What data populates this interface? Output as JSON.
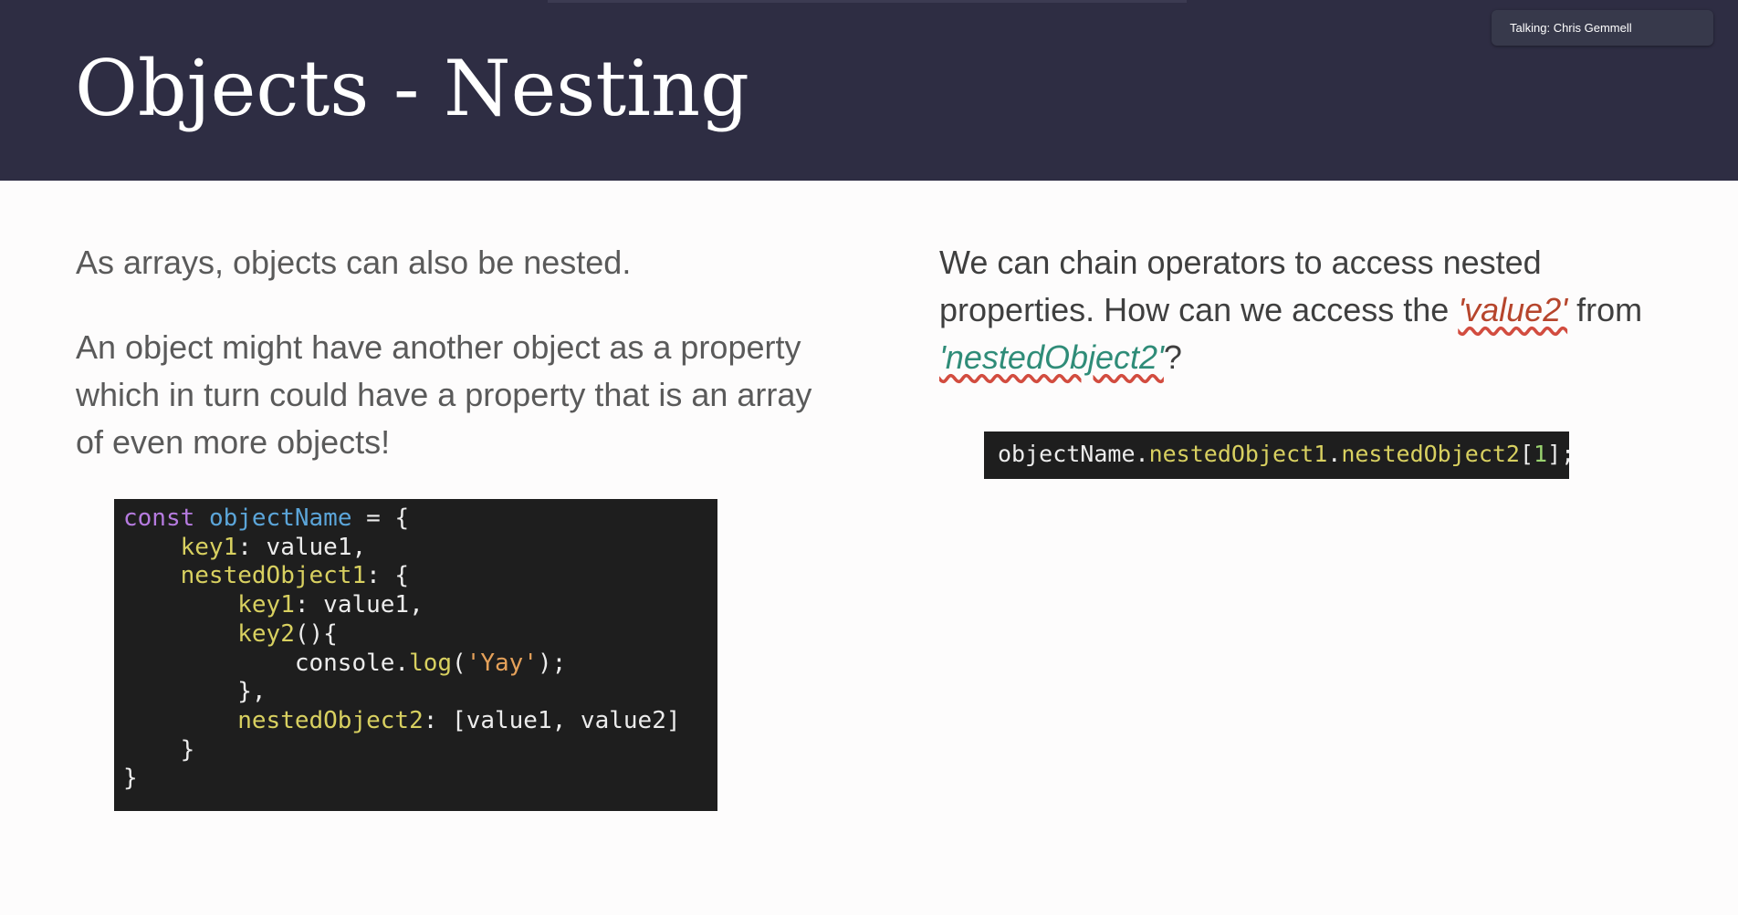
{
  "header": {
    "title": "Objects - Nesting",
    "talking_indicator": "Talking: Chris Gemmell"
  },
  "left": {
    "paragraph1": "As arrays, objects can also be nested.",
    "paragraph2": "An object might have another object as a property which in turn could have a property that is an array of even more objects!",
    "code_lines": [
      [
        "const",
        " ",
        "objectName",
        " = {"
      ],
      [
        "key1",
        ": value1,"
      ],
      [
        "nestedObject1",
        ": {"
      ],
      [
        "key1",
        ": value1,"
      ],
      [
        "key2",
        "(){"
      ],
      [
        "console.",
        "log",
        "(",
        "'Yay'",
        ");"
      ],
      [
        "},"
      ],
      [
        "nestedObject2",
        ": [value1, value2]"
      ],
      [
        "}"
      ],
      [
        "}"
      ]
    ]
  },
  "right": {
    "paragraph_before": "We can chain operators to access nested properties. How can we access the ",
    "value_ref": "'value2'",
    "paragraph_mid": " from ",
    "object_ref": "'nestedObject2'",
    "paragraph_after": "?",
    "code_parts": [
      "objectName.",
      "nestedObject1",
      ".",
      "nestedObject2",
      "[",
      "1",
      "];"
    ]
  },
  "colors": {
    "header_bg": "#2e2d43",
    "code_bg": "#1e1e1e",
    "keyword": "#b67be0",
    "identifier": "#5ba5d9",
    "property": "#d8d060",
    "string": "#e5a15a",
    "number": "#9ad36f",
    "highlight_red": "#b6452c",
    "highlight_teal": "#2f8c78"
  }
}
